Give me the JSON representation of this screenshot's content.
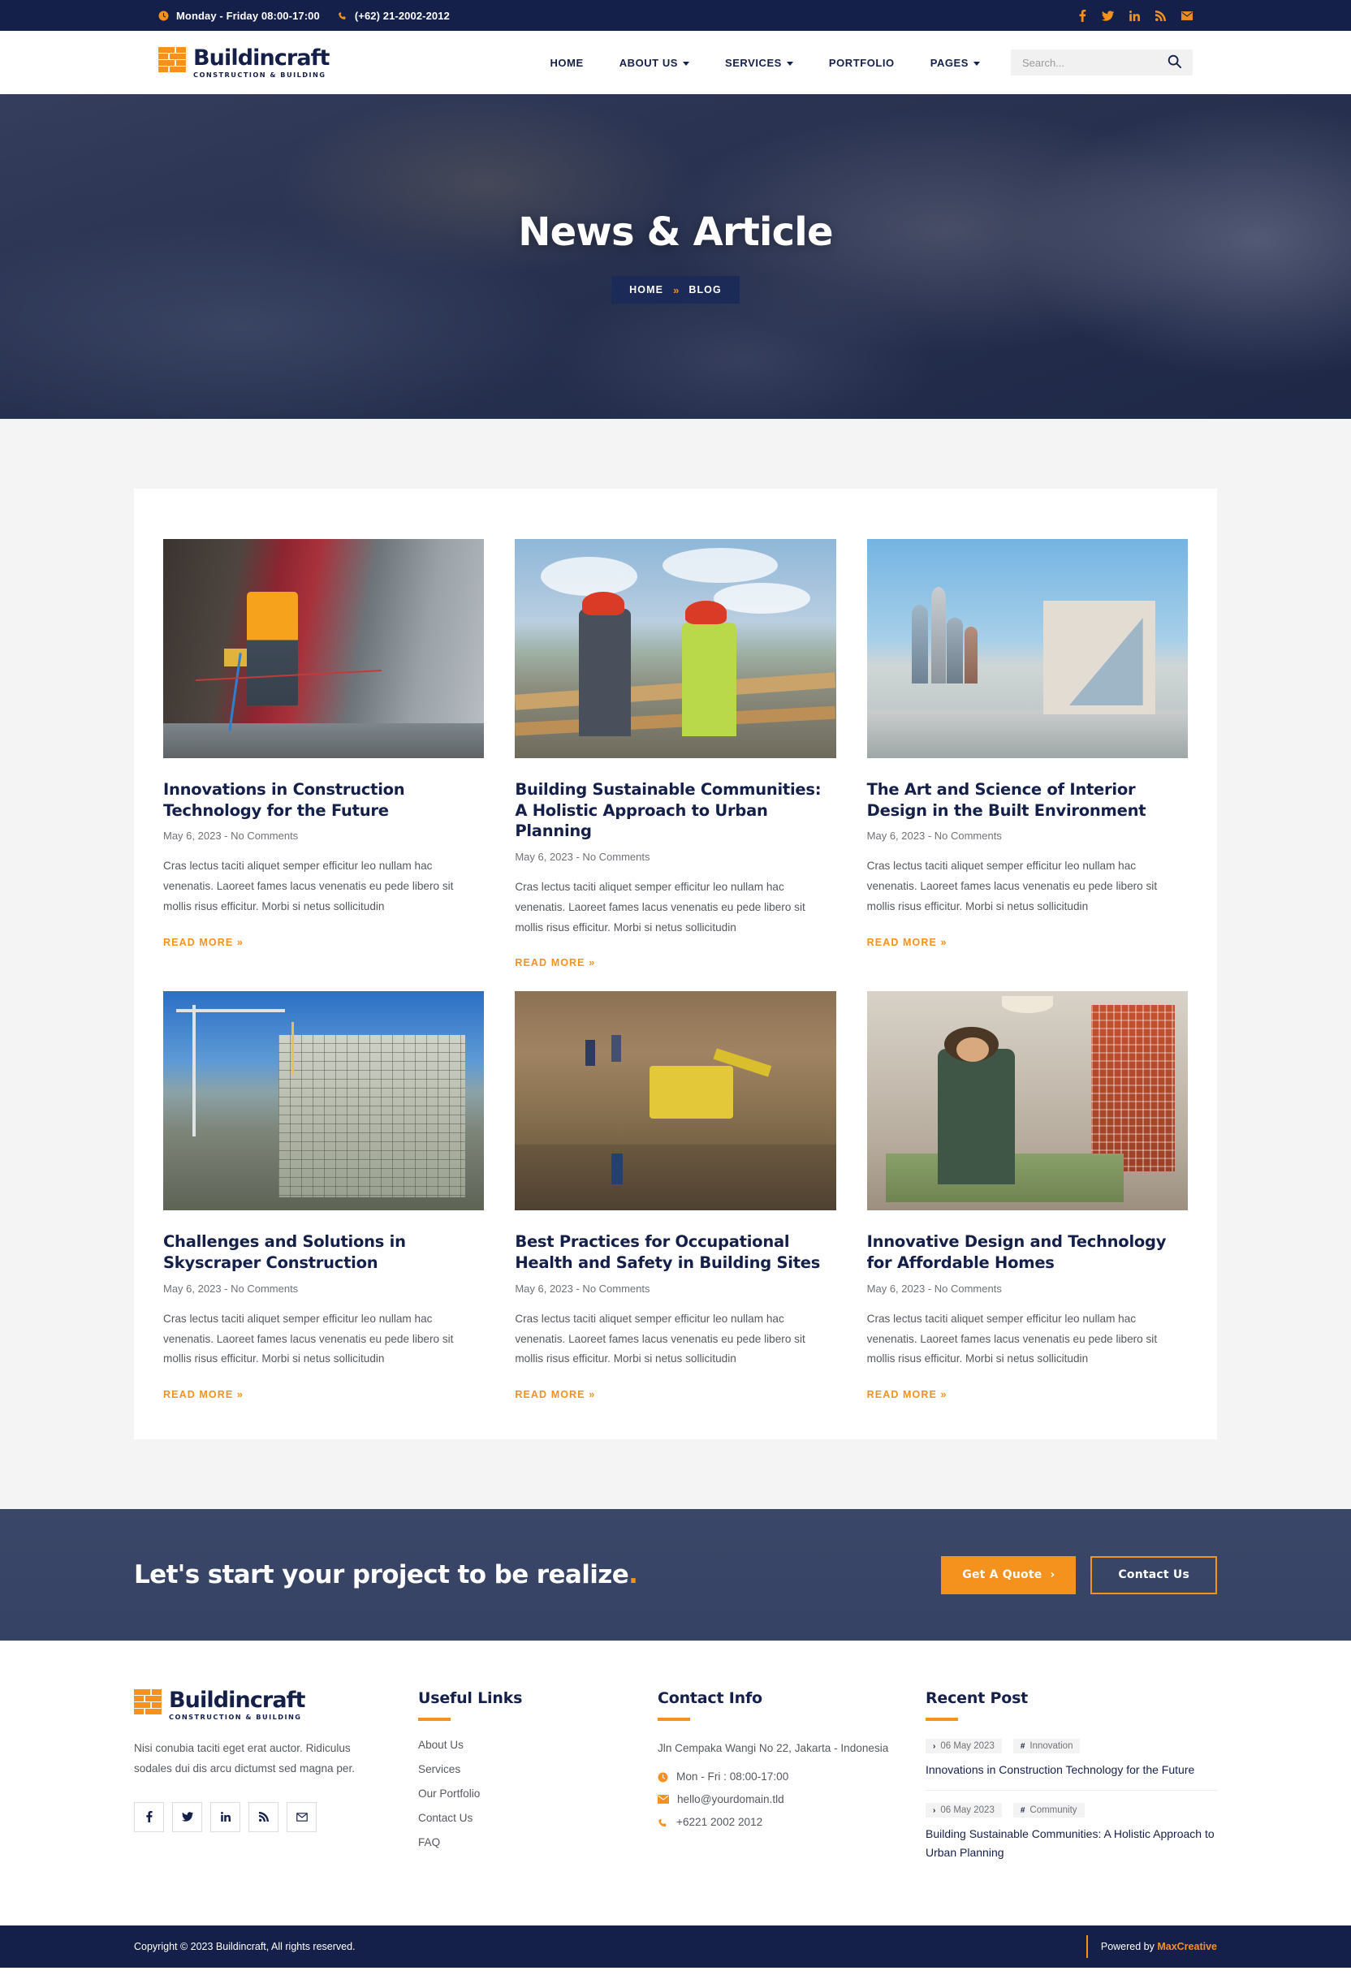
{
  "topbar": {
    "hours": "Monday - Friday 08:00-17:00",
    "phone": "(+62) 21-2002-2012",
    "socials": [
      "facebook-icon",
      "twitter-icon",
      "linkedin-icon",
      "rss-icon",
      "email-icon"
    ]
  },
  "brand": {
    "name": "Buildincraft",
    "tagline": "CONSTRUCTION & BUILDING"
  },
  "nav": {
    "items": [
      {
        "label": "HOME",
        "caret": false
      },
      {
        "label": "ABOUT US",
        "caret": true
      },
      {
        "label": "SERVICES",
        "caret": true
      },
      {
        "label": "PORTFOLIO",
        "caret": false
      },
      {
        "label": "PAGES",
        "caret": true
      }
    ],
    "search_placeholder": "Search..."
  },
  "hero": {
    "title": "News & Article",
    "breadcrumb_home": "HOME",
    "breadcrumb_sep": "»",
    "breadcrumb_current": "BLOG"
  },
  "blog": {
    "read_more": "READ MORE »",
    "posts": [
      {
        "title": "Innovations in Construction Technology for the Future",
        "meta": "May 6, 2023 - No Comments",
        "excerpt": "Cras lectus taciti aliquet semper efficitur leo nullam hac venenatis. Laoreet fames lacus venenatis eu pede libero sit mollis risus efficitur. Morbi si netus sollicitudin",
        "image": "construction-worker-harness-photo"
      },
      {
        "title": "Building Sustainable Communities: A Holistic Approach to Urban Planning",
        "meta": "May 6, 2023 - No Comments",
        "excerpt": "Cras lectus taciti aliquet semper efficitur leo nullam hac venenatis. Laoreet fames lacus venenatis eu pede libero sit mollis risus efficitur. Morbi si netus sollicitudin",
        "image": "two-engineers-hardhats-photo"
      },
      {
        "title": "The Art and Science of Interior Design in the Built Environment",
        "meta": "May 6, 2023 - No Comments",
        "excerpt": "Cras lectus taciti aliquet semper efficitur leo nullam hac venenatis. Laoreet fames lacus venenatis eu pede libero sit mollis risus efficitur. Morbi si netus sollicitudin",
        "image": "modern-architecture-skyline-photo"
      },
      {
        "title": "Challenges and Solutions in Skyscraper Construction",
        "meta": "May 6, 2023 - No Comments",
        "excerpt": "Cras lectus taciti aliquet semper efficitur leo nullam hac venenatis. Laoreet fames lacus venenatis eu pede libero sit mollis risus efficitur. Morbi si netus sollicitudin",
        "image": "highrise-under-construction-photo"
      },
      {
        "title": "Best Practices for Occupational Health and Safety in Building Sites",
        "meta": "May 6, 2023 - No Comments",
        "excerpt": "Cras lectus taciti aliquet semper efficitur leo nullam hac venenatis. Laoreet fames lacus venenatis eu pede libero sit mollis risus efficitur. Morbi si netus sollicitudin",
        "image": "excavator-trench-site-photo"
      },
      {
        "title": "Innovative Design and Technology for Affordable Homes",
        "meta": "May 6, 2023 - No Comments",
        "excerpt": "Cras lectus taciti aliquet semper efficitur leo nullam hac venenatis. Laoreet fames lacus venenatis eu pede libero sit mollis risus efficitur. Morbi si netus sollicitudin",
        "image": "architect-with-scale-model-photo"
      }
    ]
  },
  "cta": {
    "title_main": "Let's start your project to be realize",
    "title_dot": ".",
    "quote_label": "Get A Quote",
    "quote_arrow": "›",
    "contact_label": "Contact Us"
  },
  "footer": {
    "about": "Nisi conubia taciti eget erat auctor. Ridiculus sodales dui dis arcu dictumst sed magna per.",
    "socials": [
      "facebook-icon",
      "twitter-icon",
      "linkedin-icon",
      "rss-icon",
      "email-icon"
    ],
    "links_head": "Useful Links",
    "links": [
      "About Us",
      "Services",
      "Our Portfolio",
      "Contact Us",
      "FAQ"
    ],
    "contact_head": "Contact Info",
    "address": "Jln Cempaka Wangi No 22, Jakarta - Indonesia",
    "hours": "Mon - Fri : 08:00-17:00",
    "email": "hello@yourdomain.tld",
    "phone": "+6221 2002 2012",
    "recent_head": "Recent Post",
    "recent": [
      {
        "date": "06 May 2023",
        "tag": "Innovation",
        "title": "Innovations in Construction Technology for the Future"
      },
      {
        "date": "06 May 2023",
        "tag": "Community",
        "title": "Building Sustainable Communities: A Holistic Approach to Urban Planning"
      }
    ]
  },
  "bottom": {
    "copyright": "Copyright © 2023 Buildincraft, All rights reserved.",
    "powered_prefix": "Powered by ",
    "powered_brand": "MaxCreative"
  },
  "colors": {
    "navy": "#15204a",
    "orange": "#f5921e",
    "bodyText": "#55585e",
    "pageBg": "#f4f4f4"
  }
}
